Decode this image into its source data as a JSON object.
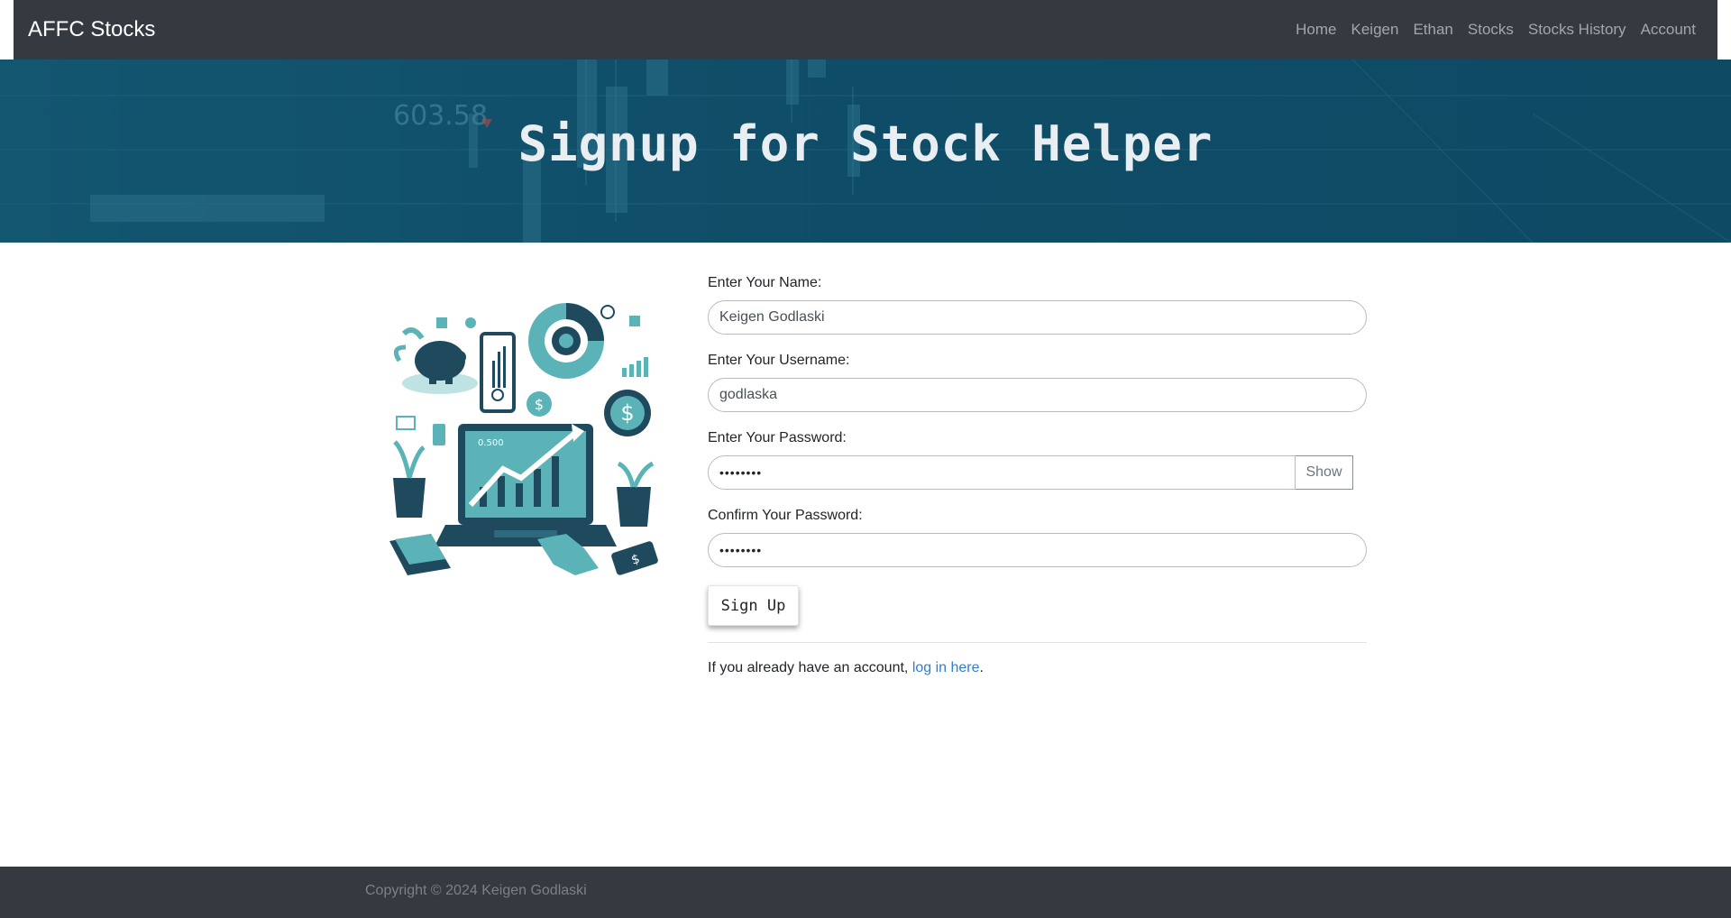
{
  "navbar": {
    "brand": "AFFC Stocks",
    "links": [
      "Home",
      "Keigen",
      "Ethan",
      "Stocks",
      "Stocks History",
      "Account"
    ]
  },
  "hero": {
    "title": "Signup for Stock Helper",
    "bg_number": "603.58"
  },
  "illustration": {
    "screen_value": "0.500"
  },
  "form": {
    "name_label": "Enter Your Name:",
    "name_value": "Keigen Godlaski",
    "username_label": "Enter Your Username:",
    "username_value": "godlaska",
    "password_label": "Enter Your Password:",
    "password_value": "••••••••",
    "show_label": "Show",
    "confirm_label": "Confirm Your Password:",
    "confirm_value": "••••••••",
    "submit_label": "Sign Up",
    "login_prefix": "If you already have an account, ",
    "login_link": "log in here",
    "login_suffix": "."
  },
  "footer": {
    "copyright": "Copyright © 2024 Keigen Godlaski"
  },
  "colors": {
    "navbar_bg": "#343a40",
    "hero_bg": "#0f4c67",
    "link": "#2d7fd3",
    "accent_teal": "#5bb3b8",
    "dark_navy": "#1f4a5e"
  }
}
